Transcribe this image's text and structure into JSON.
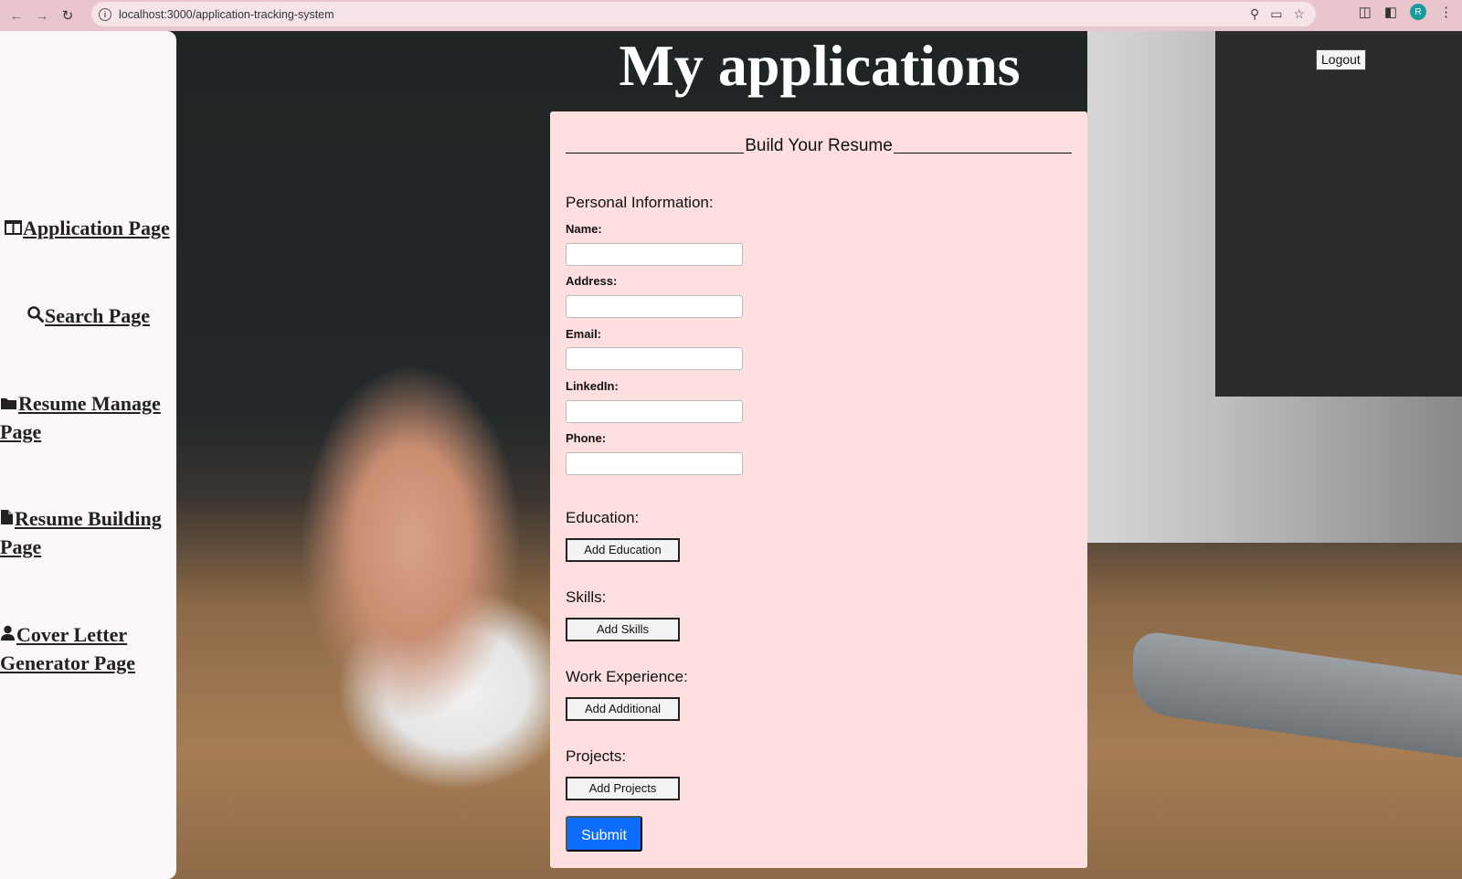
{
  "browser": {
    "url": "localhost:3000/application-tracking-system",
    "profile_initial": "R"
  },
  "sidebar": {
    "items": [
      {
        "icon": "table-columns-icon",
        "label": "Application Page"
      },
      {
        "icon": "search-icon",
        "label": "Search Page"
      },
      {
        "icon": "folder-icon",
        "label": "Resume Manage Page"
      },
      {
        "icon": "file-icon",
        "label": "Resume Building Page"
      },
      {
        "icon": "user-icon",
        "label": "Cover Letter Generator Page"
      }
    ]
  },
  "header": {
    "title": "My applications",
    "logout_label": "Logout"
  },
  "form": {
    "heading": "Build Your Resume",
    "personal_title": "Personal Information:",
    "fields": [
      {
        "label": "Name:",
        "value": ""
      },
      {
        "label": "Address:",
        "value": ""
      },
      {
        "label": "Email:",
        "value": ""
      },
      {
        "label": "LinkedIn:",
        "value": ""
      },
      {
        "label": "Phone:",
        "value": ""
      }
    ],
    "sections": [
      {
        "title": "Education:",
        "button": "Add Education"
      },
      {
        "title": "Skills:",
        "button": "Add Skills"
      },
      {
        "title": "Work Experience:",
        "button": "Add Additional"
      },
      {
        "title": "Projects:",
        "button": "Add Projects"
      }
    ],
    "submit_label": "Submit"
  },
  "colors": {
    "card_background": "#fddfe0",
    "submit_button": "#0d6efd",
    "sidebar_background": "#fcf7fa"
  }
}
